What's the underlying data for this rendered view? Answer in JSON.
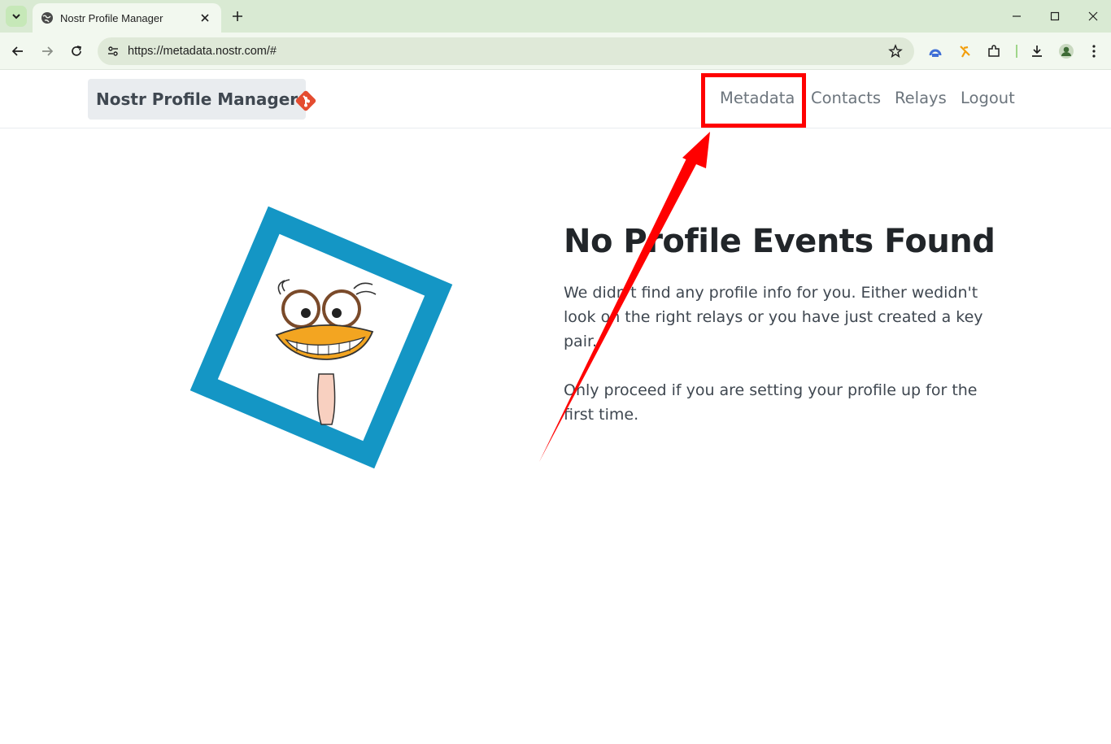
{
  "browser": {
    "tab_title": "Nostr Profile Manager",
    "url": "https://metadata.nostr.com/#"
  },
  "navbar": {
    "brand": "Nostr Profile Manager",
    "links": {
      "metadata": "Metadata",
      "contacts": "Contacts",
      "relays": "Relays",
      "logout": "Logout"
    }
  },
  "hero": {
    "heading": "No Profile Events Found",
    "paragraph1": "We didn't find any profile info for you. Either wedidn't look on the right relays or you have just created a key pair.",
    "paragraph2": "Only proceed if you are setting your profile up for the first time."
  },
  "colors": {
    "annotation": "#ff0000",
    "frame": "#1496c5",
    "git": "#e44c30"
  },
  "icons": [
    "tab-search-icon",
    "globe-icon",
    "close-icon",
    "plus-icon",
    "minimize-icon",
    "maximize-icon",
    "back-icon",
    "forward-icon",
    "reload-icon",
    "site-info-icon",
    "star-icon",
    "extension-icon",
    "download-icon",
    "profile-icon",
    "menu-icon",
    "git-logo-icon"
  ]
}
